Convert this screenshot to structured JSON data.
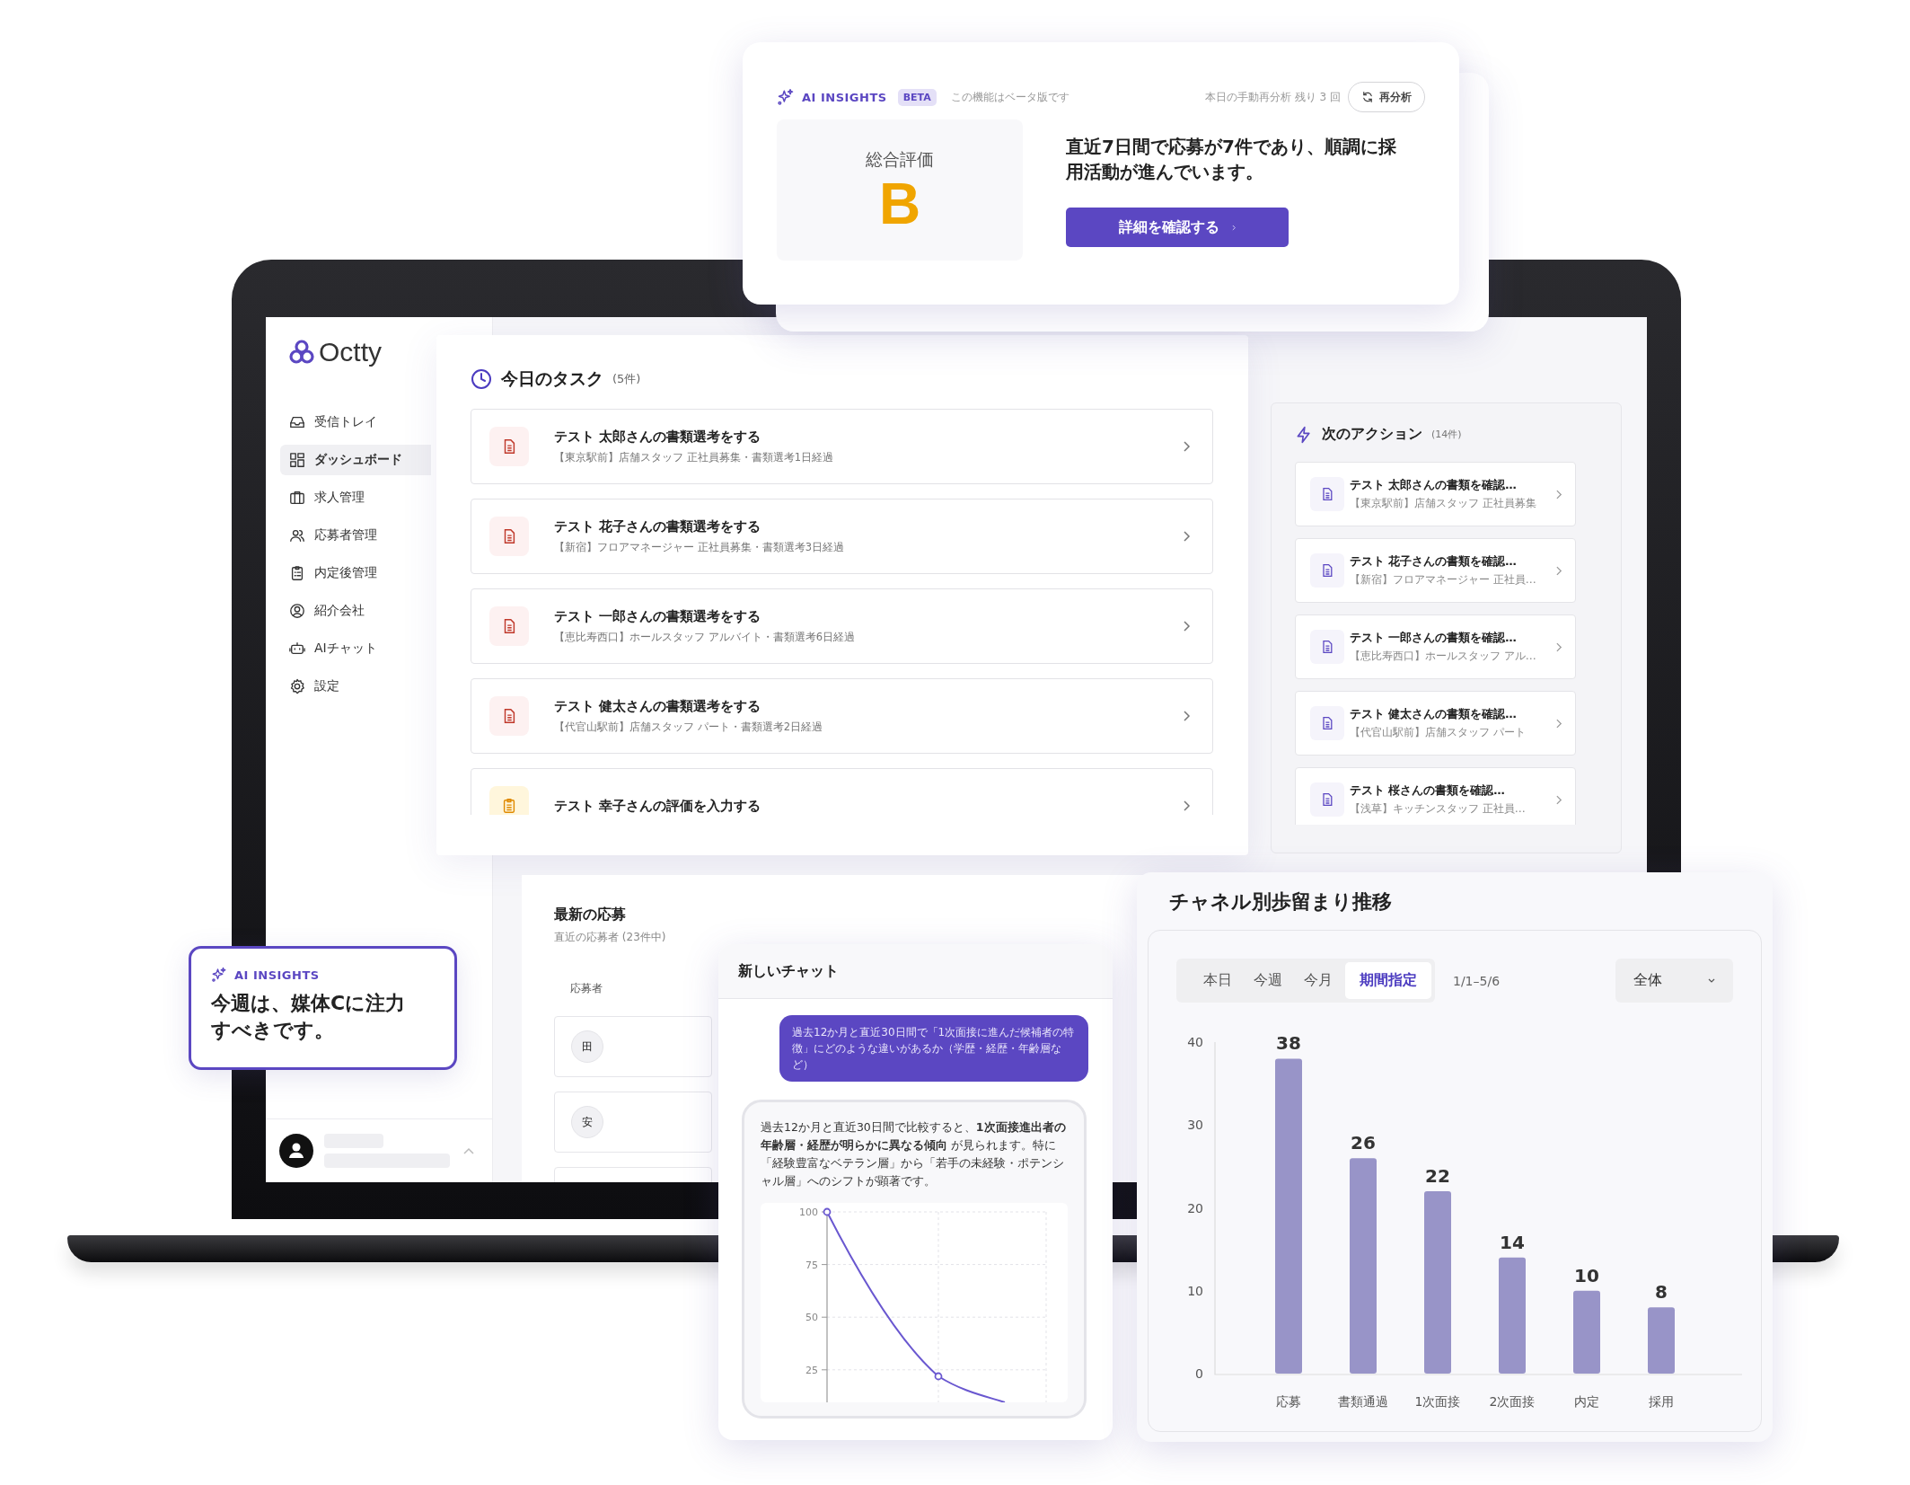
{
  "insight_card": {
    "label": "AI INSIGHTS",
    "badge": "BETA",
    "note": "この機能はベータ版です",
    "remaining": "本日の手動再分析 残り 3 回",
    "reanalyze_button": "再分析",
    "grade_label": "総合評価",
    "grade": "B",
    "summary": "直近7日間で応募が7件であり、順調に採用活動が進んでいます。",
    "details_button": "詳細を確認する"
  },
  "sidebar": {
    "logo": "Octty",
    "items": [
      {
        "label": "受信トレイ",
        "selected": false
      },
      {
        "label": "ダッシュボード",
        "selected": true
      },
      {
        "label": "求人管理",
        "selected": false
      },
      {
        "label": "応募者管理",
        "selected": false
      },
      {
        "label": "内定後管理",
        "selected": false
      },
      {
        "label": "紹介会社",
        "selected": false
      },
      {
        "label": "AIチャット",
        "selected": false
      },
      {
        "label": "設定",
        "selected": false
      }
    ]
  },
  "tasks": {
    "title": "今日のタスク",
    "count": "(5件)",
    "items": [
      {
        "kind": "document",
        "title": "テスト 太郎さんの書類選考をする",
        "detail": "【東京駅前】店舗スタッフ 正社員募集・書類選考1日経過"
      },
      {
        "kind": "document",
        "title": "テスト 花子さんの書類選考をする",
        "detail": "【新宿】フロアマネージャー 正社員募集・書類選考3日経過"
      },
      {
        "kind": "document",
        "title": "テスト 一郎さんの書類選考をする",
        "detail": "【恵比寿西口】ホールスタッフ アルバイト・書類選考6日経過"
      },
      {
        "kind": "document",
        "title": "テスト 健太さんの書類選考をする",
        "detail": "【代官山駅前】店舗スタッフ パート・書類選考2日経過"
      },
      {
        "kind": "evaluation",
        "title": "テスト 幸子さんの評価を入力する"
      }
    ]
  },
  "next_actions": {
    "title": "次のアクション",
    "count": "(14件)",
    "items": [
      {
        "title": "テスト 太郎さんの書類を確認…",
        "detail": "【東京駅前】店舗スタッフ 正社員募集"
      },
      {
        "title": "テスト 花子さんの書類を確認…",
        "detail": "【新宿】フロアマネージャー 正社員…"
      },
      {
        "title": "テスト 一郎さんの書類を確認…",
        "detail": "【恵比寿西口】ホールスタッフ アル…"
      },
      {
        "title": "テスト 健太さんの書類を確認…",
        "detail": "【代官山駅前】店舗スタッフ パート"
      },
      {
        "title": "テスト 桜さんの書類を確認…",
        "detail": "【浅草】キッチンスタッフ 正社員…"
      }
    ]
  },
  "recent_applications": {
    "title": "最新の応募",
    "subtitle": "直近の応募者 (23件中)",
    "column": "応募者",
    "rows": [
      {
        "initial": "田"
      },
      {
        "initial": "安"
      }
    ]
  },
  "focus_card": {
    "label": "AI INSIGHTS",
    "message": "今週は、媒体Cに注力すべきです。"
  },
  "chat": {
    "title": "新しいチャット",
    "question": "過去12か月と直近30日間で「1次面接に進んだ候補者の特徴」にどのような違いがあるか（学歴・経歴・年齢層など）",
    "answer": "過去12か月と直近30日間で比較すると、**1次面接進出者の年齢層・経歴が明らかに異なる傾向** が見られます。特に「経験豊富なベテラン層」から「若手の未経験・ポテンシャル層」へのシフトが顕著です。",
    "chart_ticks": [
      "100",
      "75",
      "50",
      "25"
    ]
  },
  "funnel": {
    "title": "チャネル別歩留まり推移",
    "periods": [
      {
        "label": "本日",
        "selected": false
      },
      {
        "label": "今週",
        "selected": false
      },
      {
        "label": "今月",
        "selected": false
      },
      {
        "label": "期間指定",
        "selected": true
      }
    ],
    "date_range": "1/1–5/6",
    "filter": "全体",
    "chart_data": {
      "type": "bar",
      "categories": [
        "応募",
        "書類通過",
        "1次面接",
        "2次面接",
        "内定",
        "採用"
      ],
      "values": [
        38,
        26,
        22,
        14,
        10,
        8
      ],
      "ylim": [
        0,
        40
      ],
      "yticks": [
        0,
        10,
        20,
        30,
        40
      ],
      "data_labels": true
    }
  }
}
